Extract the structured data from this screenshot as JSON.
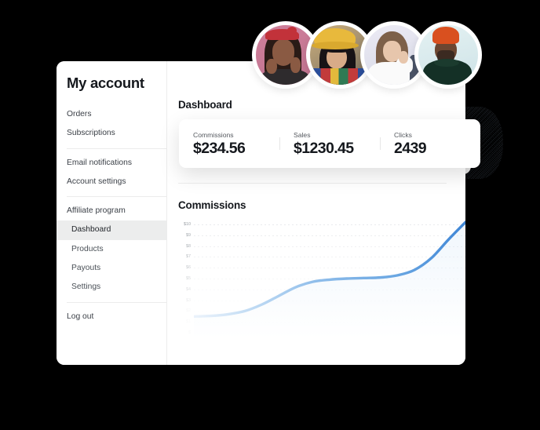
{
  "sidebar": {
    "title": "My account",
    "groups": [
      {
        "items": [
          {
            "label": "Orders",
            "active": false,
            "sub": false
          },
          {
            "label": "Subscriptions",
            "active": false,
            "sub": false
          }
        ]
      },
      {
        "items": [
          {
            "label": "Email notifications",
            "active": false,
            "sub": false
          },
          {
            "label": "Account settings",
            "active": false,
            "sub": false
          }
        ]
      },
      {
        "items": [
          {
            "label": "Affiliate program",
            "active": false,
            "sub": false
          },
          {
            "label": "Dashboard",
            "active": true,
            "sub": true
          },
          {
            "label": "Products",
            "active": false,
            "sub": true
          },
          {
            "label": "Payouts",
            "active": false,
            "sub": true
          },
          {
            "label": "Settings",
            "active": false,
            "sub": true
          }
        ]
      },
      {
        "items": [
          {
            "label": "Log out",
            "active": false,
            "sub": false
          }
        ]
      }
    ]
  },
  "main": {
    "page_title": "Dashboard",
    "chart_section_title": "Commissions"
  },
  "stats": [
    {
      "label": "Commissions",
      "value": "$234.56"
    },
    {
      "label": "Sales",
      "value": "$1230.45"
    },
    {
      "label": "Clicks",
      "value": "2439"
    }
  ],
  "avatars": [
    {
      "name": "avatar-woman-red-bandana",
      "bg": "#c0738f"
    },
    {
      "name": "avatar-woman-yellow-hat",
      "bg": "#9d8b6d"
    },
    {
      "name": "avatar-woman-white-shirt",
      "bg": "#dfe0ec"
    },
    {
      "name": "avatar-man-orange-beanie",
      "bg": "#d7e9ec"
    }
  ],
  "colors": {
    "accent_line": "#4a90e2",
    "accent_line_light": "#cfe3f7",
    "card_bg": "#ffffff",
    "sidebar_active": "#eceded",
    "grid": "#e9ebed",
    "text_dark": "#15181d",
    "text_muted": "#55595f",
    "page_bg": "#000000"
  },
  "chart_data": {
    "type": "line",
    "title": "Commissions",
    "xlabel": "",
    "ylabel": "",
    "grid": true,
    "legend": false,
    "ylim": [
      0,
      10
    ],
    "ytick_labels": [
      "$10",
      "$9",
      "$8",
      "$7",
      "$6",
      "$5",
      "$4",
      "$3",
      "$2",
      "$1",
      "$"
    ],
    "ytick_values": [
      10,
      9,
      8,
      7,
      6,
      5,
      4,
      3,
      2,
      1,
      0
    ],
    "x": [
      0,
      1,
      2,
      3,
      4,
      5,
      6,
      7,
      8,
      9,
      10,
      11,
      12,
      13,
      14,
      15,
      16
    ],
    "series": [
      {
        "name": "Commissions",
        "values": [
          1.5,
          1.55,
          1.7,
          2.0,
          2.6,
          3.4,
          4.2,
          4.7,
          4.9,
          5.0,
          5.05,
          5.1,
          5.3,
          5.8,
          6.9,
          8.6,
          10.2
        ]
      }
    ]
  }
}
